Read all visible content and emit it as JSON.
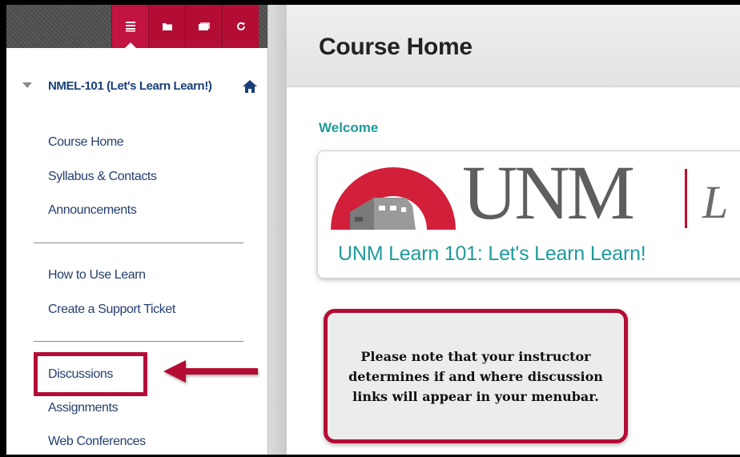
{
  "sidebar": {
    "tabs": [
      {
        "icon": "menu-list-icon"
      },
      {
        "icon": "folder-icon"
      },
      {
        "icon": "window-icon"
      },
      {
        "icon": "refresh-icon"
      }
    ],
    "course_title": "NMEL-101 (Let's Learn Learn!)",
    "course_links": [
      "Course Home",
      "Syllabus & Contacts",
      "Announcements"
    ],
    "help_links": [
      "How to Use Learn",
      "Create a Support Ticket"
    ],
    "tool_links": [
      "Discussions",
      "Assignments",
      "Web Conferences"
    ]
  },
  "main": {
    "title": "Course Home",
    "welcome": "Welcome",
    "banner": {
      "logo_text": "UNM",
      "logo_suffix": "L",
      "subtitle": "UNM Learn 101: Let's Learn Learn!"
    },
    "callout": "Please note that your instructor determines if and where discussion links will appear in your menubar."
  },
  "colors": {
    "accent": "#b30d35",
    "link": "#243f6e",
    "teal": "#1e9a9b"
  }
}
